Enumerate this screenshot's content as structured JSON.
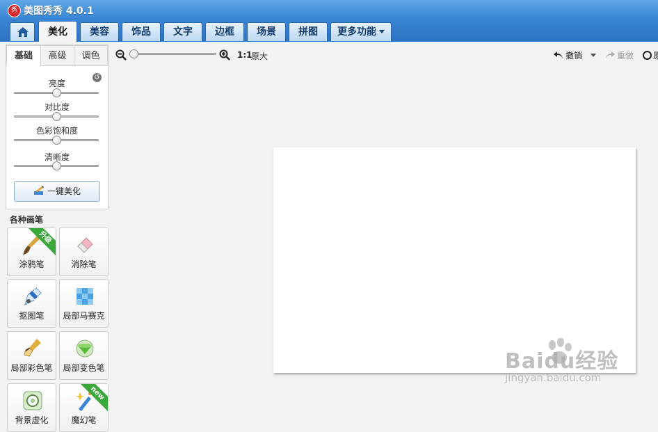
{
  "app": {
    "logo_text": "秀",
    "title": "美图秀秀 4.0.1"
  },
  "nav": {
    "tabs": [
      {
        "label": "美化"
      },
      {
        "label": "美容"
      },
      {
        "label": "饰品"
      },
      {
        "label": "文字"
      },
      {
        "label": "边框"
      },
      {
        "label": "场景"
      },
      {
        "label": "拼图"
      },
      {
        "label": "更多功能"
      }
    ],
    "active_tab": "美化"
  },
  "adjust": {
    "tabs": [
      "基础",
      "高级",
      "调色"
    ],
    "active_tab": "基础",
    "sliders": [
      {
        "label": "亮度",
        "value": 0.5
      },
      {
        "label": "对比度",
        "value": 0.5
      },
      {
        "label": "色彩饱和度",
        "value": 0.5
      },
      {
        "label": "清晰度",
        "value": 0.5
      }
    ],
    "one_click_label": "一键美化"
  },
  "brushes": {
    "title": "各种画笔",
    "items": [
      {
        "label": "涂鸦笔",
        "badge": "升级",
        "icon": "paint-brush-icon"
      },
      {
        "label": "消除笔",
        "badge": "",
        "icon": "eraser-icon"
      },
      {
        "label": "抠图笔",
        "badge": "",
        "icon": "cutout-pen-icon"
      },
      {
        "label": "局部马赛克",
        "badge": "",
        "icon": "mosaic-icon"
      },
      {
        "label": "局部彩色笔",
        "badge": "",
        "icon": "color-brush-icon"
      },
      {
        "label": "局部变色笔",
        "badge": "",
        "icon": "paint-bucket-icon"
      },
      {
        "label": "背景虚化",
        "badge": "",
        "icon": "blur-icon"
      },
      {
        "label": "魔幻笔",
        "badge": "new",
        "icon": "magic-wand-icon"
      }
    ]
  },
  "toolbar": {
    "zoom_value": 0,
    "ratio_label": "1:1",
    "actual_size_label": "原大",
    "undo_label": "撤销",
    "redo_label": "重做",
    "extra_label": "原"
  },
  "watermark": {
    "main": "Baidu经验",
    "sub": "jingyan.baidu.com"
  },
  "colors": {
    "title_bar": "#3a86d4",
    "tab_active": "#f4f4f4",
    "badge_green": "#3aa83a",
    "canvas_bg": "#f2f2f2"
  }
}
